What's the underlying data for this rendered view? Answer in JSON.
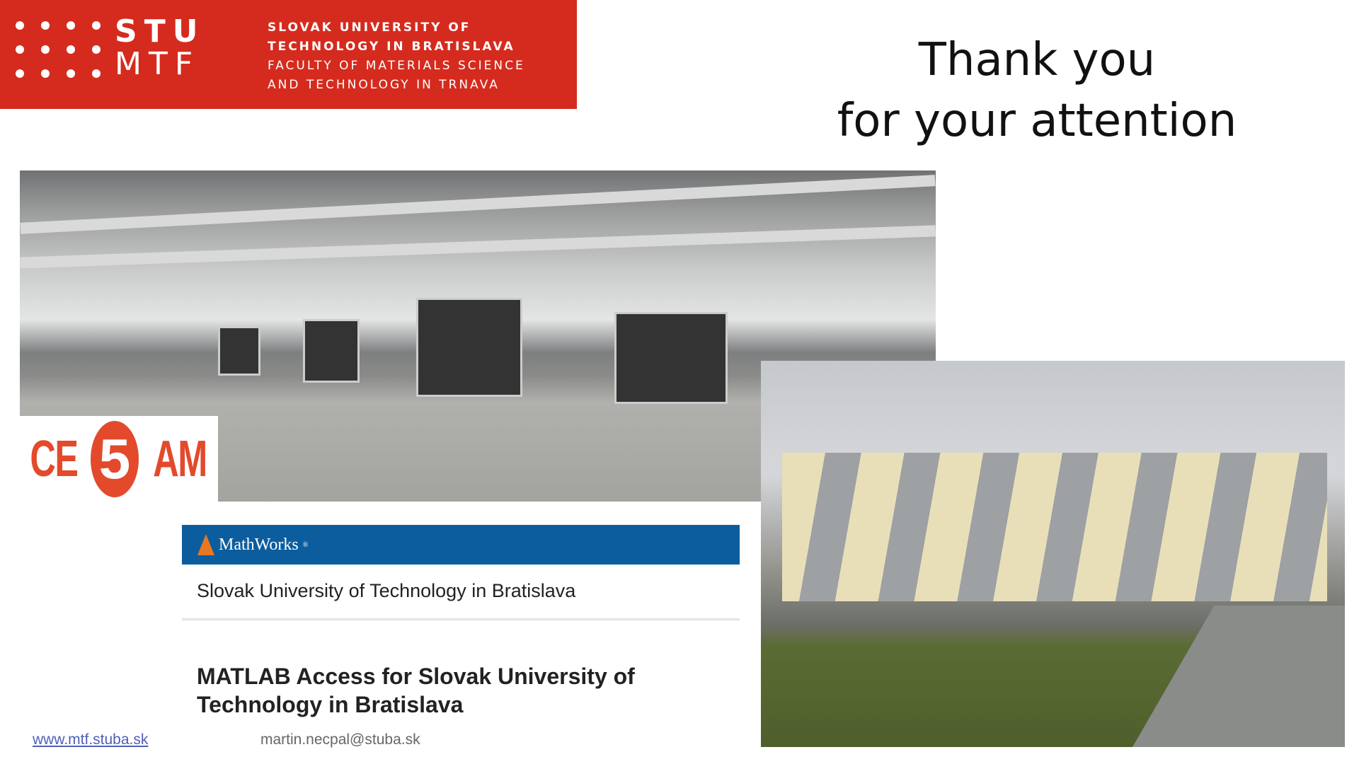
{
  "header": {
    "logo_line1": "STU",
    "logo_line2": "MTF",
    "university": [
      "SLOVAK UNIVERSITY OF",
      "TECHNOLOGY IN BRATISLAVA"
    ],
    "faculty": [
      "FACULTY OF MATERIALS SCIENCE",
      "AND TECHNOLOGY IN TRNAVA"
    ],
    "brand_color": "#d52b1e"
  },
  "title": {
    "line1": "Thank you",
    "line2": "for your attention"
  },
  "ce5am_logo": {
    "left": "CE",
    "digit": "5",
    "right": "AM"
  },
  "mathworks": {
    "brand": "MathWorks",
    "registered": "®",
    "organization": "Slovak University of Technology in Bratislava",
    "heading": "MATLAB Access for Slovak University of Technology in Bratislava",
    "header_color": "#0c5d9e"
  },
  "footer": {
    "website": "www.mtf.stuba.sk",
    "email": "martin.necpal@stuba.sk"
  }
}
